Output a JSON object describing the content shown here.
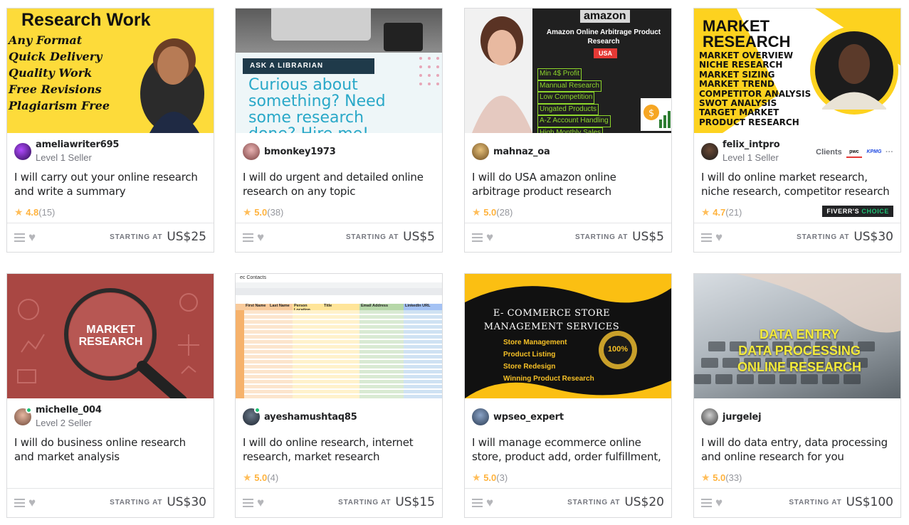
{
  "labels": {
    "starting_at": "STARTING AT"
  },
  "cards": [
    {
      "seller": "ameliawriter695",
      "level": "Level 1 Seller",
      "title": "I will carry out your online research and write a summary",
      "score": "4.8",
      "count": "(15)",
      "price": "US$25",
      "thumb": {
        "heading": "Research Work",
        "lines": [
          "Any Format",
          "Quick Delivery",
          "Quality Work",
          "Free Revisions",
          "Plagiarism Free"
        ]
      }
    },
    {
      "seller": "bmonkey1973",
      "level": "",
      "title": "I will do urgent and detailed online research on any topic",
      "score": "5.0",
      "count": "(38)",
      "price": "US$5",
      "thumb": {
        "tag": "ASK A LIBRARIAN",
        "text": "Curious about something? Need some research done? Hire me!"
      }
    },
    {
      "seller": "mahnaz_oa",
      "level": "",
      "title": "I will do USA amazon online arbitrage product research",
      "score": "5.0",
      "count": "(28)",
      "price": "US$5",
      "thumb": {
        "brand": "amazon",
        "heading": "Amazon Online Arbitrage Product Research",
        "tag": "USA",
        "lines": [
          "Min 4$ Profit",
          "Mannual Research",
          "Low Competition",
          "Ungated Products",
          "A-Z Account Handling",
          "High Monthly Sales"
        ]
      }
    },
    {
      "seller": "felix_intpro",
      "level": "Level 1 Seller",
      "title": "I will do online market research, niche research, competitor research and...",
      "score": "4.7",
      "count": "(21)",
      "price": "US$30",
      "clients_label": "Clients",
      "client_logos": [
        "pwc",
        "KPMG"
      ],
      "more": "···",
      "badge_main": "FIVERR'S",
      "badge_tail": "CHOICE",
      "thumb": {
        "heading": "MARKET RESEARCH",
        "lines": [
          "MARKET OVERVIEW",
          "NICHE RESEARCH",
          "MARKET SIZING",
          "MARKET TREND",
          "COMPETITOR ANALYSIS",
          "SWOT ANALYSIS",
          "TARGET MARKET",
          "PRODUCT RESEARCH"
        ]
      }
    },
    {
      "seller": "michelle_004",
      "level": "Level 2 Seller",
      "title": "I will do business online research and market analysis",
      "score": "",
      "count": "",
      "price": "US$30",
      "thumb": {
        "heading": "MARKET RESEARCH"
      }
    },
    {
      "seller": "ayeshamushtaq85",
      "level": "",
      "title": "I will do online research, internet research, market research",
      "score": "5.0",
      "count": "(4)",
      "price": "US$15",
      "thumb": {
        "sheet_title": "ec Contacts",
        "columns": [
          "First Name",
          "Last Name",
          "Person Location",
          "Title",
          "Email Address",
          "LinkedIn URL"
        ]
      }
    },
    {
      "seller": "wpseo_expert",
      "level": "",
      "title": "I will manage ecommerce online store, product add, order fulfillment, produ...",
      "score": "5.0",
      "count": "(3)",
      "price": "US$20",
      "thumb": {
        "heading": "E- COMMERCE STORE MANAGEMENT SERVICES",
        "lines": [
          "Store Management",
          "Product Listing",
          "Store Redesign",
          "Winning Product Research"
        ],
        "seal": "100%"
      }
    },
    {
      "seller": "jurgelej",
      "level": "",
      "title": "I will do data entry, data processing and online research for you",
      "score": "5.0",
      "count": "(33)",
      "price": "US$100",
      "thumb": {
        "lines": [
          "DATA ENTRY",
          "DATA PROCESSING",
          "ONLINE RESEARCH"
        ]
      }
    }
  ],
  "colors": {
    "accent_green": "#1dbf73",
    "star": "#ffbe5b",
    "text": "#222325",
    "muted": "#74767e"
  }
}
